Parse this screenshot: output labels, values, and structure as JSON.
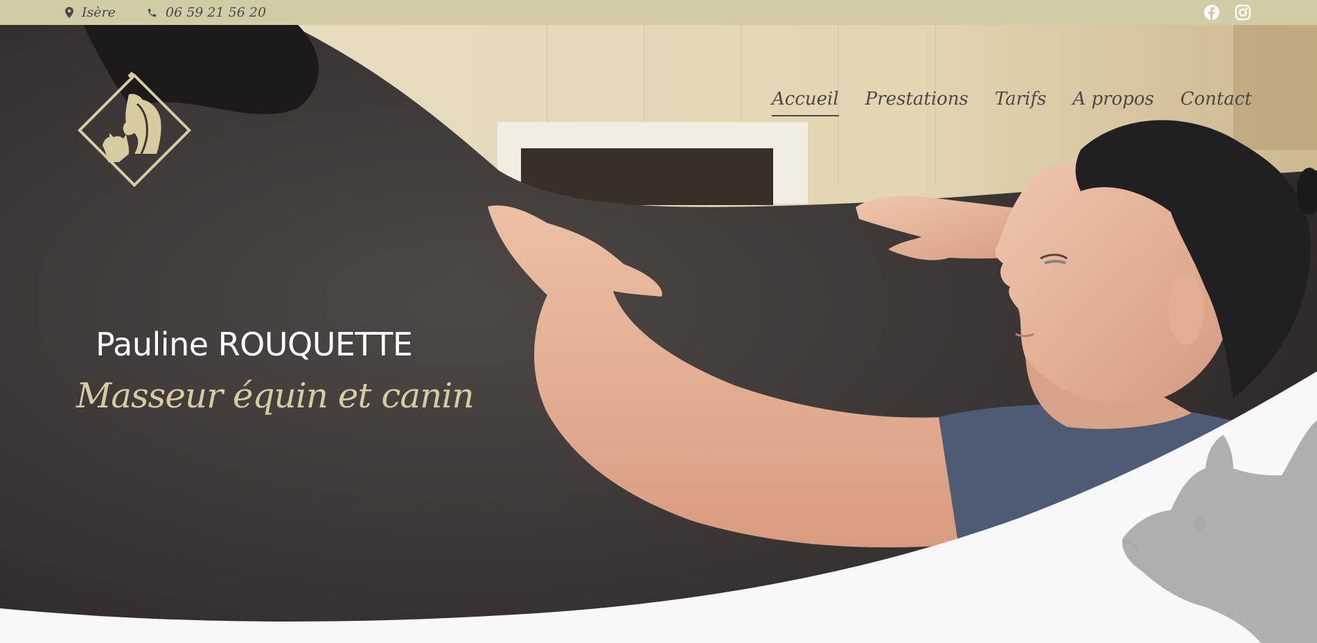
{
  "topbar": {
    "location": "Isère",
    "phone": "06 59 21 56 20",
    "icons": [
      "map-marker-icon",
      "phone-icon",
      "facebook-icon",
      "instagram-icon"
    ]
  },
  "nav": {
    "items": [
      {
        "label": "Accueil",
        "active": true
      },
      {
        "label": "Prestations",
        "active": false
      },
      {
        "label": "Tarifs",
        "active": false
      },
      {
        "label": "A propos",
        "active": false
      },
      {
        "label": "Contact",
        "active": false
      }
    ]
  },
  "hero": {
    "name": "Pauline ROUQUETTE",
    "subtitle": "Masseur équin et canin"
  },
  "colors": {
    "topbar": "#d2cca6",
    "accent": "#d7cba0",
    "nav_text": "#4b4a44",
    "background": "#f8f8f8"
  }
}
